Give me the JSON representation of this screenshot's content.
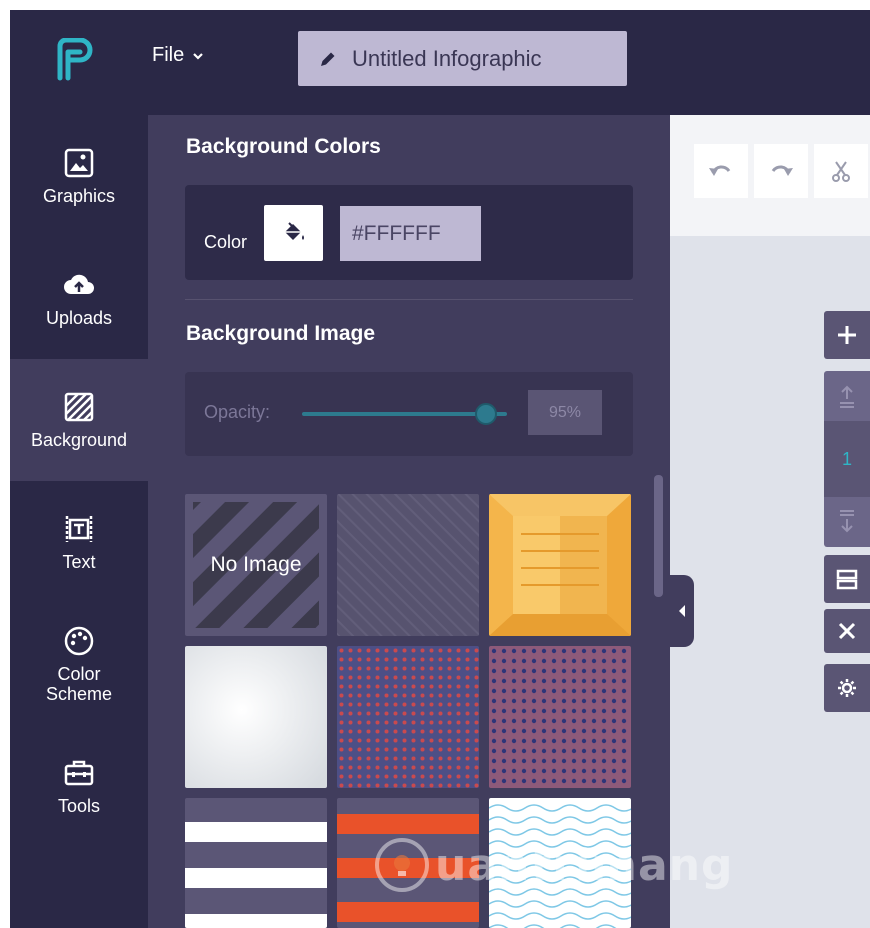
{
  "header": {
    "file_label": "File",
    "document_title": "Untitled Infographic"
  },
  "sidebar": {
    "items": [
      {
        "label": "Graphics",
        "icon": "image-icon"
      },
      {
        "label": "Uploads",
        "icon": "cloud-upload-icon"
      },
      {
        "label": "Background",
        "icon": "hatch-icon",
        "active": true
      },
      {
        "label": "Text",
        "icon": "text-box-icon"
      },
      {
        "label": "Color\nScheme",
        "icon": "palette-icon"
      },
      {
        "label": "Tools",
        "icon": "toolbox-icon"
      }
    ]
  },
  "panel": {
    "colors_heading": "Background Colors",
    "color_label": "Color",
    "color_value": "#FFFFFF",
    "image_heading": "Background Image",
    "opacity_label": "Opacity:",
    "opacity_value": "95%",
    "opacity_fraction": 0.95,
    "no_image_label": "No Image"
  },
  "canvas": {
    "page_number": "1"
  },
  "watermark": {
    "text": "uantrimang"
  },
  "colors": {
    "dark_bg": "#2a2846",
    "panel_bg": "#413d5d",
    "accent_teal": "#2fb5c6",
    "input_bg": "#beb8d3"
  }
}
